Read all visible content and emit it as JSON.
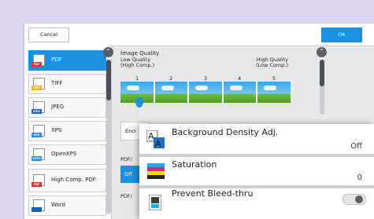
{
  "topbar": {
    "cancel_label": "Cancel",
    "ok_label": "OK"
  },
  "sidebar": {
    "items": [
      {
        "label": "PDF",
        "tag": "PDF",
        "tag_color": "#e0312c",
        "selected": true
      },
      {
        "label": "TIFF",
        "tag": "TIFF",
        "tag_color": "#f2b51c",
        "selected": false
      },
      {
        "label": "JPEG",
        "tag": "JPEG",
        "tag_color": "#1d5fb0",
        "selected": false
      },
      {
        "label": "XPS",
        "tag": "XPS",
        "tag_color": "#2e8bdf",
        "selected": false
      },
      {
        "label": "OpenXPS",
        "tag": "OXPS",
        "tag_color": "#2e8bdf",
        "selected": false
      },
      {
        "label": "High Comp. PDF",
        "tag": "PDF",
        "tag_color": "#e0312c",
        "selected": false
      },
      {
        "label": "Word",
        "tag": "",
        "tag_color": "#1d5fb0",
        "selected": false
      }
    ]
  },
  "image_quality": {
    "title": "Image Quality",
    "low_label": "Low Quality\n(High Comp.)",
    "high_label": "High Quality\n(Low Comp.)",
    "ticks": [
      "1",
      "2",
      "3",
      "4",
      "5"
    ],
    "selected": 1
  },
  "main": {
    "encryption_label": "Encr",
    "pdfa_label": "PDF/",
    "off_label": "Off",
    "pdfa2_label": "PDF/"
  },
  "overlay": {
    "background_density": {
      "title": "Background Density Adj.",
      "value": "Off"
    },
    "saturation": {
      "title": "Saturation",
      "value": "0"
    },
    "prevent_bleed": {
      "title": "Prevent Bleed-thru",
      "enabled": false
    }
  },
  "colors": {
    "accent": "#1b8fe0",
    "window_bg": "#e6e7e9",
    "page_bg": "#ddd6ee"
  },
  "icons": {
    "scroll_up": "chevron-up-icon",
    "row_chevron": "chevron-right-icon",
    "density": "text-density-icon",
    "saturation": "color-bars-icon",
    "bleed": "document-bleed-icon"
  }
}
